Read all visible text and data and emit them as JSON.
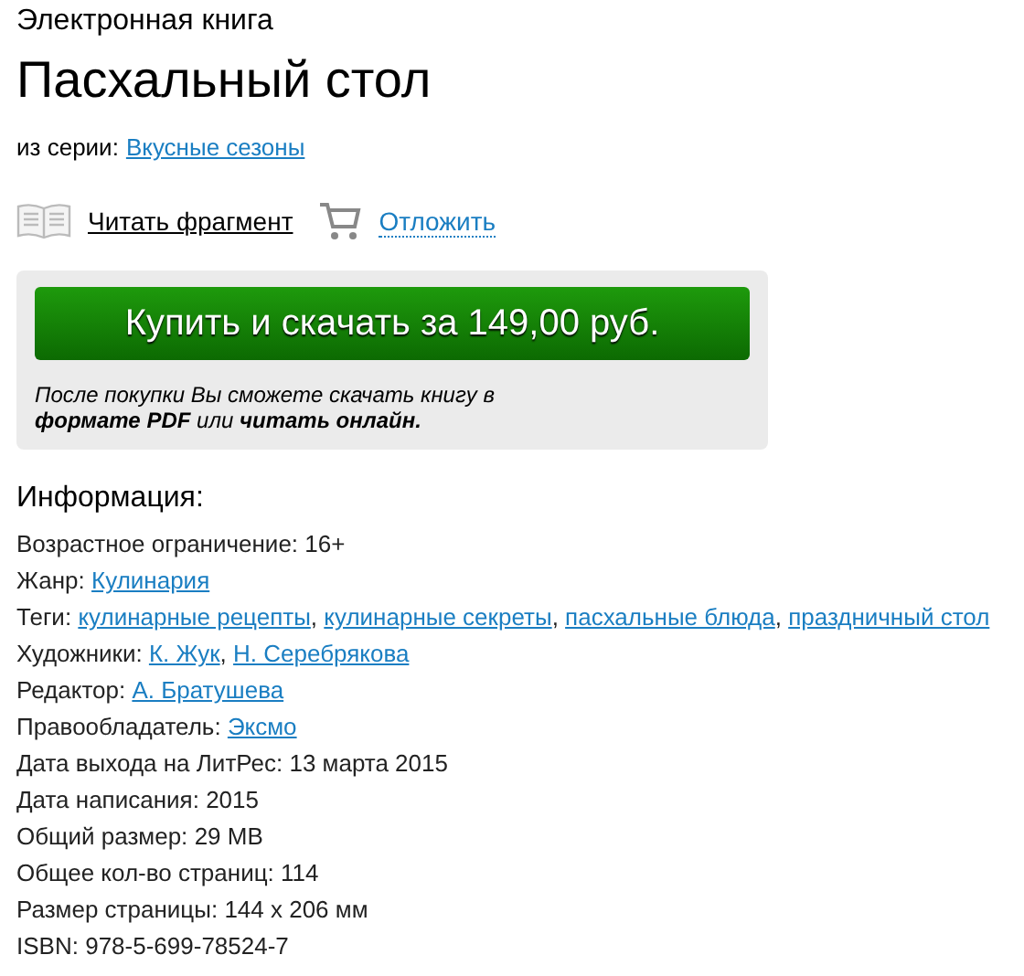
{
  "type_label": "Электронная книга",
  "title": "Пасхальный стол",
  "series": {
    "label": "из серии:",
    "link": "Вкусные сезоны"
  },
  "actions": [
    {
      "kind": "read",
      "label": "Читать фрагмент"
    },
    {
      "kind": "cart",
      "label": "Отложить"
    }
  ],
  "buy": {
    "button": "Купить и скачать за 149,00 руб.",
    "note": "После покупки Вы сможете скачать книгу в **формате PDF** или **читать онлайн.**"
  },
  "info": {
    "heading": "Информация:",
    "separator": ", ",
    "rows": [
      {
        "label": "Возрастное ограничение:",
        "value": "16+"
      },
      {
        "label": "Жанр:",
        "links": [
          "Кулинария"
        ]
      },
      {
        "label": "Теги:",
        "links": [
          "кулинарные рецепты",
          "кулинарные секреты",
          "пасхальные блюда",
          "праздничный стол"
        ]
      },
      {
        "label": "Художники:",
        "links": [
          "К. Жук",
          "Н. Серебрякова"
        ]
      },
      {
        "label": "Редактор:",
        "links": [
          "А. Братушева"
        ]
      },
      {
        "label": "Правообладатель:",
        "links": [
          "Эксмо"
        ]
      },
      {
        "label": "Дата выхода на ЛитРес:",
        "value": "13 марта 2015"
      },
      {
        "label": "Дата написания:",
        "value": "2015"
      },
      {
        "label": "Общий размер:",
        "value": "29 MB"
      },
      {
        "label": "Общее кол-во страниц:",
        "value": "114"
      },
      {
        "label": "Размер страницы:",
        "value": "144 x 206 мм"
      },
      {
        "label": "ISBN:",
        "value": "978-5-699-78524-7"
      }
    ]
  }
}
